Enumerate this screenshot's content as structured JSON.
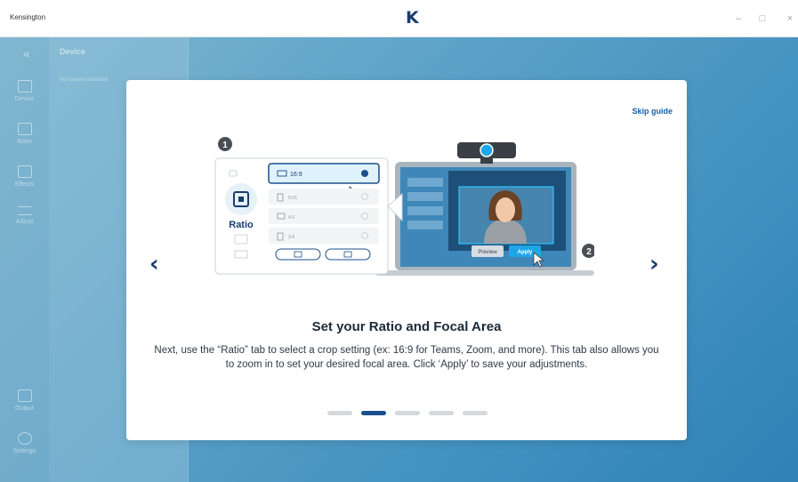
{
  "window": {
    "app_name": "Kensington",
    "logo": "K",
    "minimize": "–",
    "maximize": "□",
    "close": "×"
  },
  "sidebar": {
    "collapse_icon": "«",
    "items": [
      {
        "label": "Device",
        "icon": "camera-icon"
      },
      {
        "label": "Ratio",
        "icon": "crop-icon"
      },
      {
        "label": "Effects",
        "icon": "portrait-icon"
      },
      {
        "label": "Adjust",
        "icon": "sliders-icon"
      },
      {
        "label": "Output",
        "icon": "output-icon"
      },
      {
        "label": "Settings",
        "icon": "gear-icon"
      }
    ]
  },
  "panel": {
    "title": "Device",
    "subtitle": "No camera detected"
  },
  "guide": {
    "skip_label": "Skip guide",
    "prev_arrow": "‹",
    "next_arrow": "›",
    "heading": "Set your Ratio and Focal Area",
    "description": "Next, use the “Ratio” tab to select a crop setting (ex: 16:9 for Teams, Zoom, and more). This tab also allows you to zoom in to set your desired focal area. Click ‘Apply’ to save your adjustments.",
    "step_count": 5,
    "active_step": 2,
    "illustration": {
      "step_1": "1",
      "step_2": "2",
      "ratio_label": "Ratio",
      "options": [
        "16:9",
        "9:16",
        "4:3",
        "3:4"
      ],
      "selected_option": "16:9",
      "preview_label": "Preview",
      "apply_label": "Apply"
    }
  },
  "colors": {
    "accent_dark": "#1a3d6e",
    "link": "#1a5fa8",
    "highlight": "#1ea7e8",
    "background_blue": "#3f8fbf"
  }
}
